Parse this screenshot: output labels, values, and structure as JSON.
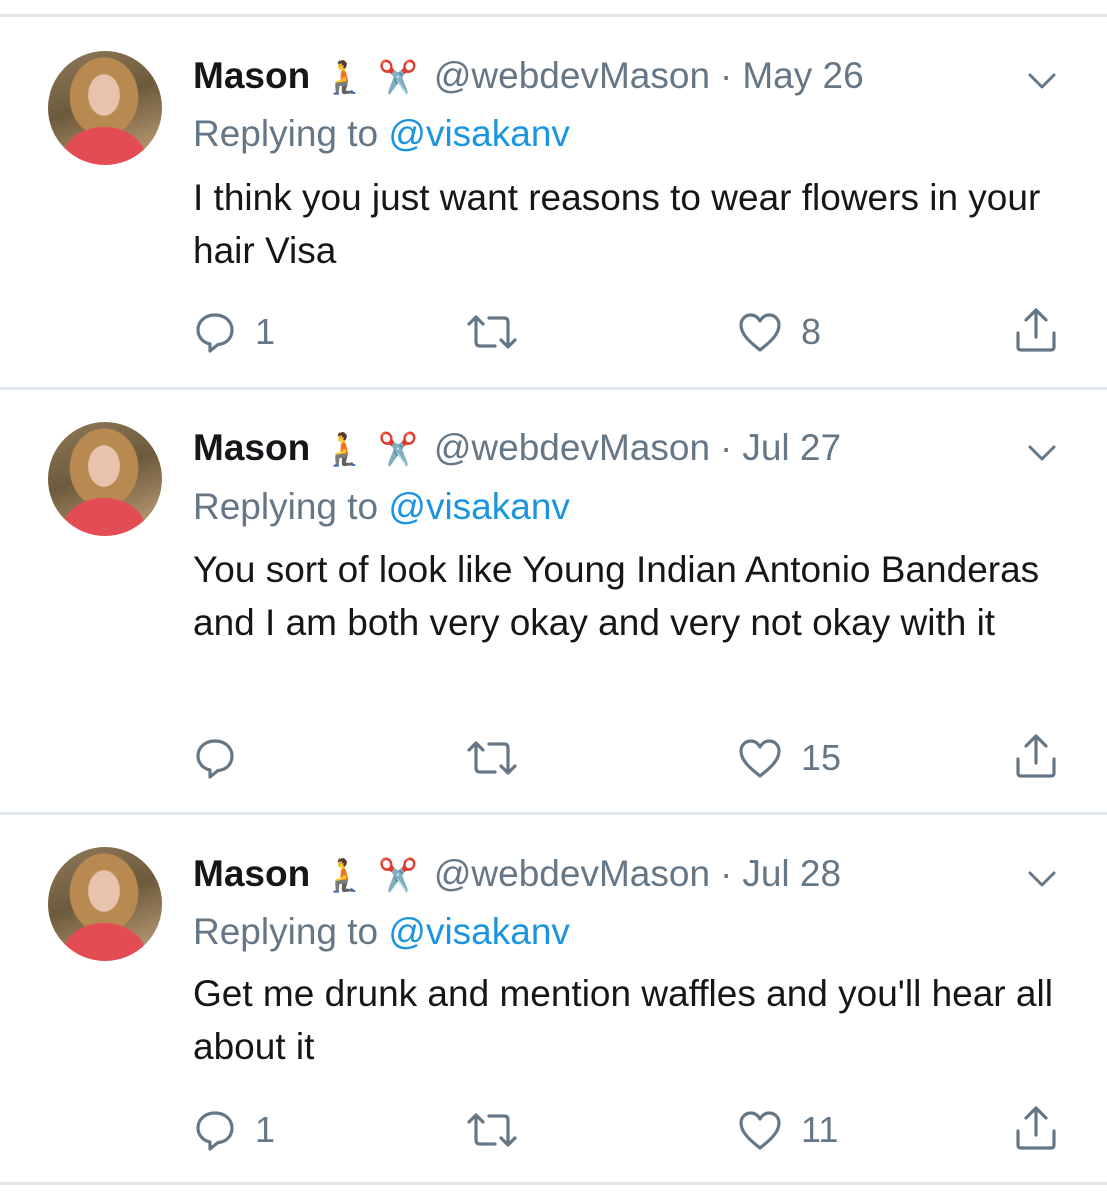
{
  "tweets": [
    {
      "author": {
        "name": "Mason",
        "emoji_1": "🧎",
        "emoji_2": "✂️",
        "handle": "@webdevMason"
      },
      "separator": "·",
      "date": "May 26",
      "replying_prefix": "Replying to",
      "replying_to": "@visakanv",
      "text": "I think you just want reasons to wear flowers in your hair Visa",
      "reply_count": "1",
      "retweet_count": "",
      "like_count": "8"
    },
    {
      "author": {
        "name": "Mason",
        "emoji_1": "🧎",
        "emoji_2": "✂️",
        "handle": "@webdevMason"
      },
      "separator": "·",
      "date": "Jul 27",
      "replying_prefix": "Replying to",
      "replying_to": "@visakanv",
      "text": "You sort of look like Young Indian Antonio Banderas and I am both very okay and very not okay with it",
      "reply_count": "",
      "retweet_count": "",
      "like_count": "15"
    },
    {
      "author": {
        "name": "Mason",
        "emoji_1": "🧎",
        "emoji_2": "✂️",
        "handle": "@webdevMason"
      },
      "separator": "·",
      "date": "Jul 28",
      "replying_prefix": "Replying to",
      "replying_to": "@visakanv",
      "text": "Get me drunk and mention waffles and you'll hear all about it",
      "reply_count": "1",
      "retweet_count": "",
      "like_count": "11"
    }
  ],
  "icons": {
    "more": "chevron-down-icon",
    "reply": "reply-icon",
    "retweet": "retweet-icon",
    "like": "heart-icon",
    "share": "share-icon"
  },
  "colors": {
    "text": "#14171a",
    "secondary": "#657786",
    "link": "#1b95e0",
    "divider": "#e1e8ed"
  }
}
